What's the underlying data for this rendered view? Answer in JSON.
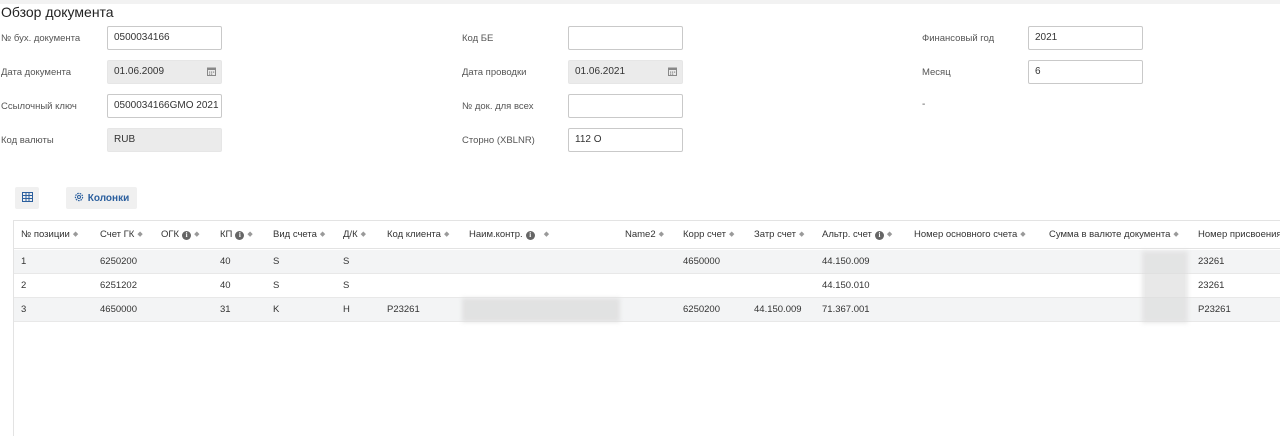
{
  "page": {
    "title": "Обзор документа"
  },
  "form": {
    "doc_number_label": "№ бух. документа",
    "doc_number_value": "0500034166",
    "doc_date_label": "Дата документа",
    "doc_date_value": "01.06.2009",
    "ref_key_label": "Ссылочный ключ",
    "ref_key_value": "0500034166GMO 2021",
    "currency_label": "Код валюты",
    "currency_value": "RUB",
    "be_code_label": "Код БЕ",
    "be_code_value": "",
    "posting_date_label": "Дата проводки",
    "posting_date_value": "01.06.2021",
    "doc_for_all_label": "№ док. для всех",
    "doc_for_all_value": "",
    "storno_label": "Сторно (XBLNR)",
    "storno_value": "112 О",
    "fiscal_year_label": "Финансовый год",
    "fiscal_year_value": "2021",
    "month_label": "Месяц",
    "month_value": "6",
    "dash": "-"
  },
  "toolbar": {
    "columns_label": "Колонки"
  },
  "table": {
    "columns": [
      "№ позиции",
      "Счет ГК",
      "ОГК",
      "КП",
      "Вид счета",
      "Д/К",
      "Код клиента",
      "Наим.контр.",
      "Name2",
      "Корр счет",
      "Затр счет",
      "Альтр. счет",
      "Номер основного счета",
      "Сумма в валюте документа",
      "Номер присвоения"
    ],
    "rows": [
      [
        "1",
        "6250200",
        "",
        "40",
        "S",
        "S",
        "",
        "",
        "",
        "4650000",
        "",
        "44.150.009",
        "",
        "",
        "23261"
      ],
      [
        "2",
        "6251202",
        "",
        "40",
        "S",
        "S",
        "",
        "",
        "",
        "",
        "",
        "44.150.010",
        "",
        "",
        "23261"
      ],
      [
        "3",
        "4650000",
        "",
        "31",
        "K",
        "H",
        "P23261",
        "",
        "",
        "6250200",
        "44.150.009",
        "71.367.001",
        "",
        "",
        "P23261"
      ]
    ]
  },
  "icons": {
    "calendar": "calendar-icon",
    "grid": "grid-icon",
    "gear": "gear-icon",
    "info": "info-icon",
    "sort": "sort-icon"
  },
  "colors": {
    "accent": "#2b5f9e",
    "readonly_bg": "#ebebeb",
    "row_alt": "#f3f4f5"
  }
}
